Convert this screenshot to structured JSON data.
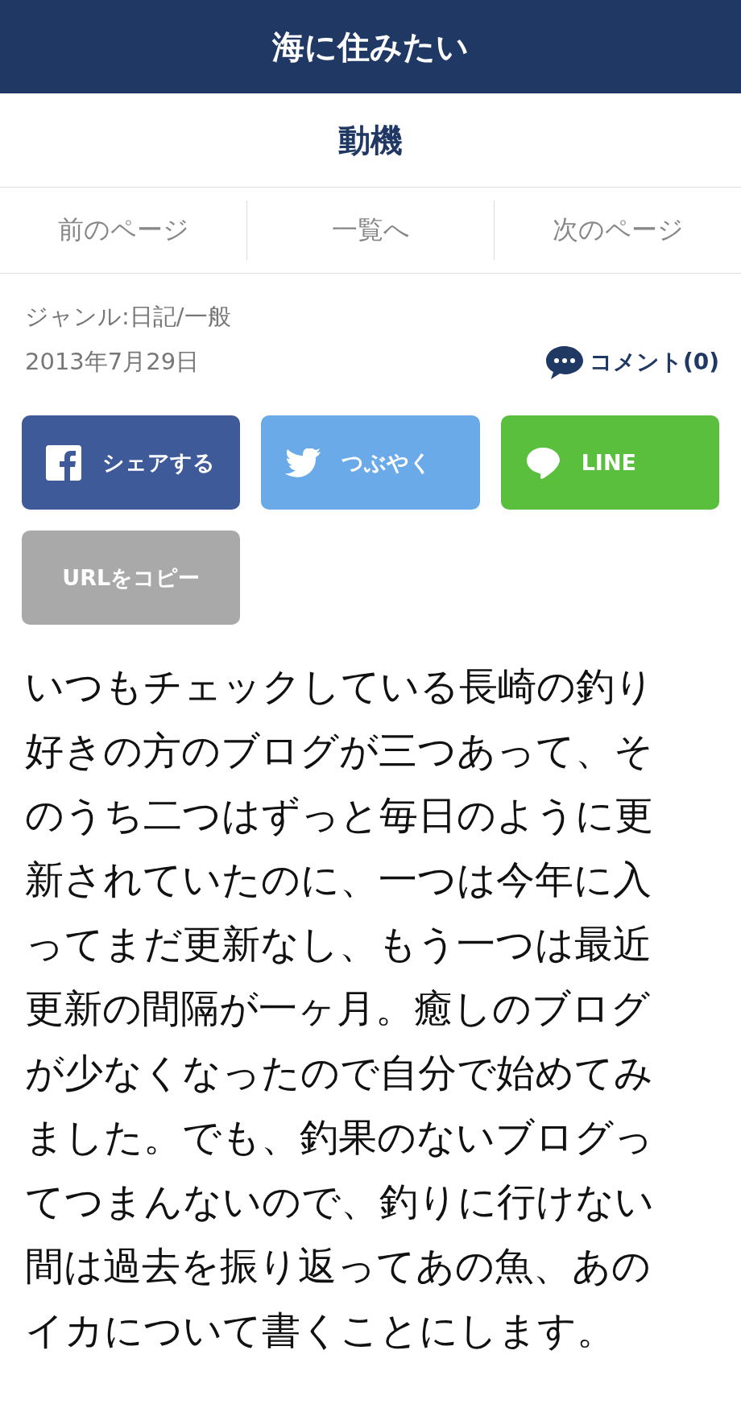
{
  "header": {
    "title": "海に住みたい"
  },
  "page_title": "動機",
  "nav": [
    {
      "label": "前のページ"
    },
    {
      "label": "一覧へ"
    },
    {
      "label": "次のページ"
    }
  ],
  "meta": {
    "genre": "ジャンル:日記/一般",
    "date": "2013年7月29日",
    "comments": "コメント(0)"
  },
  "share_buttons": [
    {
      "kind": "facebook",
      "label": "シェアする"
    },
    {
      "kind": "twitter",
      "label": "つぶやく"
    },
    {
      "kind": "line",
      "label": "LINE"
    },
    {
      "kind": "copy",
      "label": "URLをコピー"
    }
  ],
  "body": "いつもチェックしている長崎の釣り好きの方のブログが三つあって、そのうち二つはずっと毎日のように更新されていたのに、一つは今年に入ってまだ更新なし、もう一つは最近更新の間隔が一ヶ月。癒しのブログが少なくなったので自分で始めてみました。でも、釣果のないブログってつまんないので、釣りに行けない間は過去を振り返ってあの魚、あのイカについて書くことにします。"
}
